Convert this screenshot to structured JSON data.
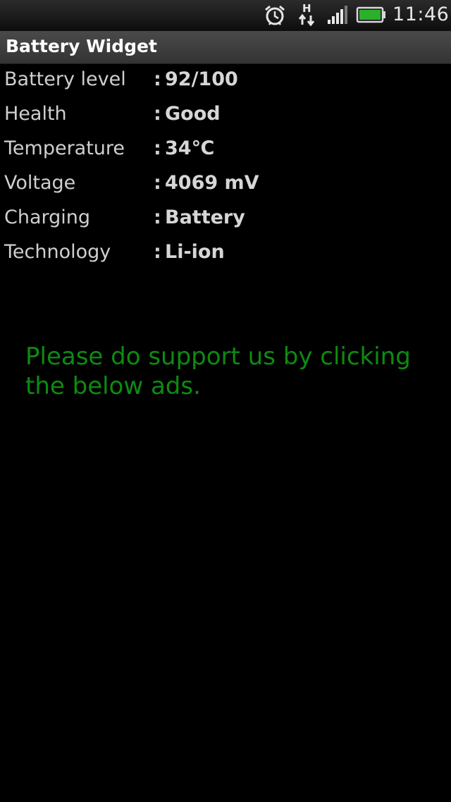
{
  "status_bar": {
    "time": "11:46",
    "network_type": "H",
    "icons": [
      "alarm-clock-icon",
      "data-transfer-icon",
      "signal-strength-icon",
      "battery-icon"
    ],
    "battery_color": "#2bb02b"
  },
  "app": {
    "title": "Battery Widget"
  },
  "info": {
    "rows": [
      {
        "label": "Battery level",
        "separator": ":",
        "value": "92/100"
      },
      {
        "label": "Health",
        "separator": ":",
        "value": "Good"
      },
      {
        "label": "Temperature",
        "separator": ":",
        "value": "34℃"
      },
      {
        "label": "Voltage",
        "separator": ":",
        "value": "4069 mV"
      },
      {
        "label": "Charging",
        "separator": ":",
        "value": "Battery"
      },
      {
        "label": "Technology",
        "separator": ":",
        "value": "Li-ion"
      }
    ]
  },
  "support_message": "Please do support us by clicking the below ads.",
  "colors": {
    "background": "#000000",
    "support_text": "#0e8a12",
    "title_bar": "#3d3d3d"
  }
}
